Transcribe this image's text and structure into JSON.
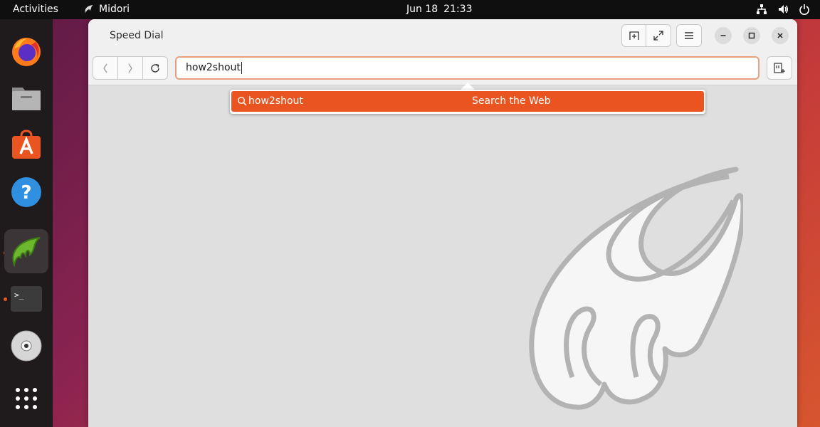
{
  "topbar": {
    "activities": "Activities",
    "app_name": "Midori",
    "date": "Jun 18",
    "time": "21:33",
    "icons": [
      "network-icon",
      "volume-icon",
      "power-icon"
    ]
  },
  "dock": {
    "items": [
      {
        "name": "Firefox",
        "icon": "firefox-icon"
      },
      {
        "name": "Files",
        "icon": "files-icon"
      },
      {
        "name": "Ubuntu Software",
        "icon": "software-icon"
      },
      {
        "name": "Help",
        "icon": "help-icon"
      },
      {
        "name": "Midori",
        "icon": "midori-icon",
        "active": true
      },
      {
        "name": "Terminal",
        "icon": "terminal-icon",
        "running": true
      },
      {
        "name": "Disc",
        "icon": "disc-icon"
      },
      {
        "name": "Show Applications",
        "icon": "app-grid-icon"
      }
    ],
    "terminal_prompt": ">_",
    "help_glyph": "?"
  },
  "browser": {
    "tab_title": "Speed Dial",
    "url_value": "how2shout",
    "suggestion": {
      "query": "how2shout",
      "action": "Search the Web"
    }
  },
  "colors": {
    "accent": "#e95420",
    "topbar": "#0f0f0f",
    "dock": "#1f1b1d",
    "window_bg": "#dfdfdf"
  }
}
